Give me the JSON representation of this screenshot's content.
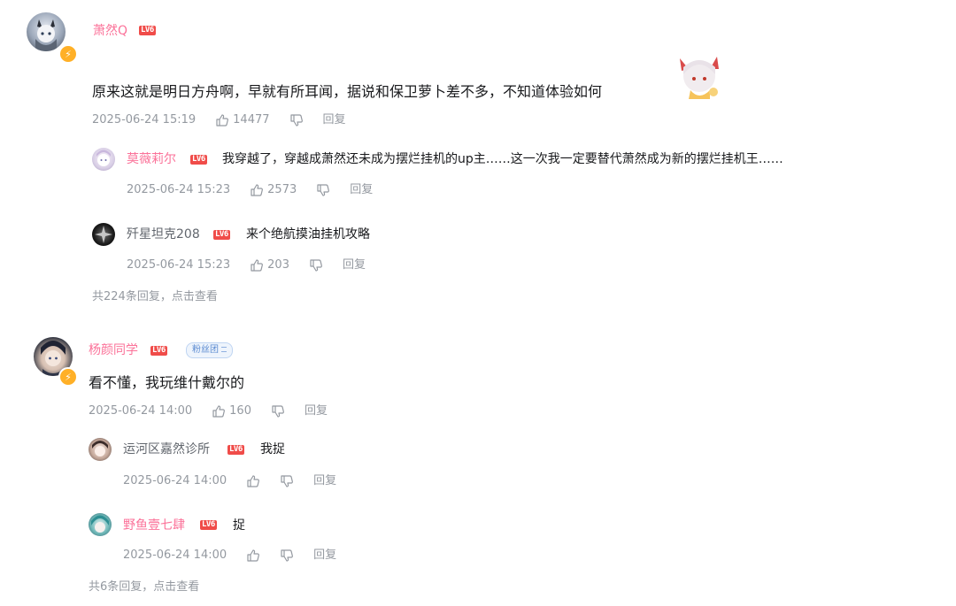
{
  "comments": [
    {
      "username": "萧然Q",
      "level": "LV6",
      "text": "原来这就是明日方舟啊，早就有所耳闻，据说和保卫萝卜差不多，不知道体验如何",
      "time": "2025-06-24 15:19",
      "likes": "14477",
      "reply_label": "回复",
      "replies": [
        {
          "username": "莫薇莉尔",
          "level": "LV6",
          "text": "我穿越了，穿越成萧然还未成为摆烂挂机的up主……这一次我一定要替代萧然成为新的摆烂挂机王……",
          "time": "2025-06-24 15:23",
          "likes": "2573",
          "reply_label": "回复"
        },
        {
          "username": "歼星坦克208",
          "level": "LV6",
          "text": "来个绝航摸油挂机攻略",
          "time": "2025-06-24 15:23",
          "likes": "203",
          "reply_label": "回复"
        }
      ],
      "more_replies": "共224条回复，点击查看"
    },
    {
      "username": "杨颜同学",
      "level": "LV6",
      "fan_badge": "粉丝团",
      "text": "看不懂，我玩维什戴尔的",
      "time": "2025-06-24 14:00",
      "likes": "160",
      "reply_label": "回复",
      "replies": [
        {
          "username": "运河区嘉然诊所",
          "level": "LV6",
          "text": "我捉",
          "time": "2025-06-24 14:00",
          "likes": "",
          "reply_label": "回复"
        },
        {
          "username": "野鱼壹七肆",
          "level": "LV6",
          "text": "捉",
          "time": "2025-06-24 14:00",
          "likes": "",
          "reply_label": "回复"
        }
      ],
      "more_replies": "共6条回复，点击查看"
    }
  ],
  "colors": {
    "vip_name": "#fb7299",
    "normal_name": "#61666d",
    "meta": "#9499a0",
    "level_badge": "#f04c49"
  },
  "icons": [
    "lightning-badge-icon",
    "thumb-up-icon",
    "thumb-down-icon",
    "sticker-emoji"
  ]
}
